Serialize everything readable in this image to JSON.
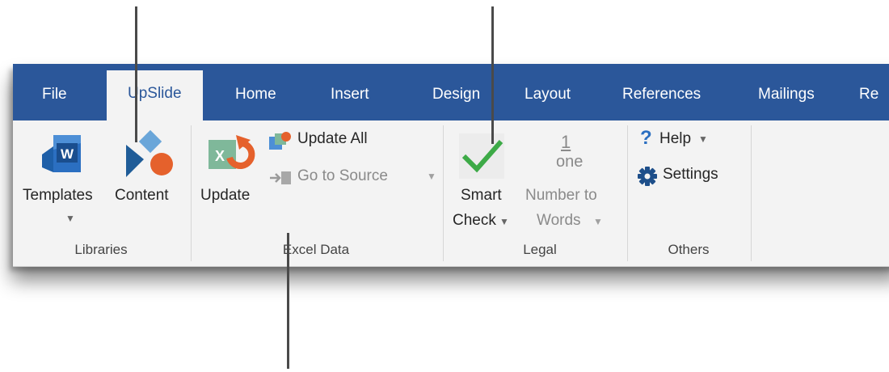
{
  "tabs": {
    "file": "File",
    "upslide": "UpSlide",
    "home": "Home",
    "insert": "Insert",
    "design": "Design",
    "layout": "Layout",
    "references": "References",
    "mailings": "Mailings",
    "review_partial": "Re"
  },
  "libraries": {
    "templates_label": "Templates",
    "content_label": "Content",
    "group_label": "Libraries"
  },
  "excel_data": {
    "update_label": "Update",
    "update_all_label": "Update All",
    "go_to_source_label": "Go to Source",
    "group_label": "Excel Data"
  },
  "legal": {
    "smart_check_line1": "Smart",
    "smart_check_line2": "Check",
    "number_to_words_line1": "Number to",
    "number_to_words_line2": "Words",
    "number_icon_top": "1",
    "number_icon_bottom": "one",
    "group_label": "Legal"
  },
  "others": {
    "help_label": "Help",
    "settings_label": "Settings",
    "group_label": "Others"
  },
  "icons": {
    "word_template": "word-template-icon",
    "content": "content-shapes-icon",
    "excel_update": "excel-update-icon",
    "update_all": "update-all-icon",
    "go_to_source": "go-to-source-icon",
    "smart_check": "checkmark-icon",
    "number_to_words": "number-to-words-icon",
    "help": "question-mark-icon",
    "settings": "gear-icon",
    "dropdown": "caret-down-icon"
  },
  "colors": {
    "tab_bar": "#2b579a",
    "ribbon_bg": "#f3f3f3",
    "content_orange": "#e5612c",
    "content_blue": "#3a7ebf",
    "check_green": "#3daa47"
  }
}
